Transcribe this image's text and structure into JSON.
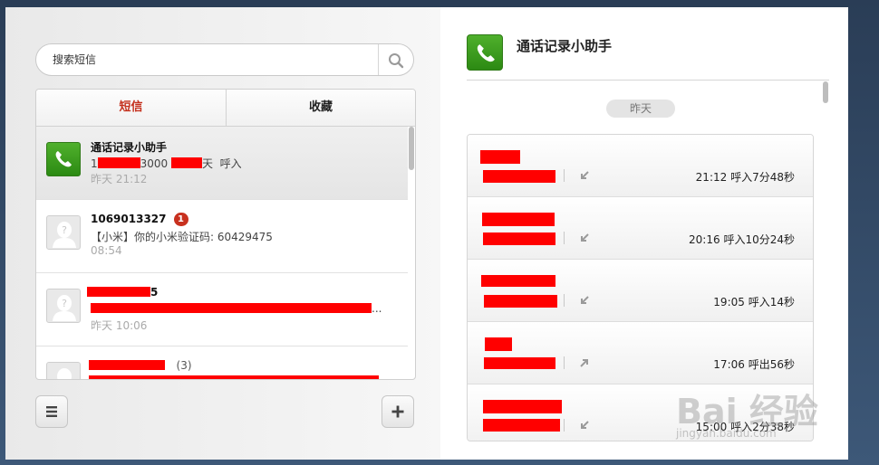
{
  "search": {
    "placeholder": "搜索短信"
  },
  "tabs": {
    "sms": "短信",
    "favorites": "收藏"
  },
  "threads": [
    {
      "name": "通话记录小助手",
      "preview_a": "1",
      "preview_b": "3000",
      "preview_c": "天",
      "preview_d": "呼入",
      "time": "昨天 21:12"
    },
    {
      "name": "1069013327",
      "badge": "1",
      "preview": "【小米】你的小米验证码: 60429475",
      "time": "08:54"
    },
    {
      "name": "5",
      "preview_tail": "...",
      "time": "昨天 10:06"
    },
    {
      "count": "(3)"
    }
  ],
  "detail": {
    "title": "通话记录小助手",
    "date": "昨天",
    "calls": [
      {
        "direction": "incoming",
        "time": "21:12",
        "info": "呼入7分48秒"
      },
      {
        "direction": "incoming",
        "time": "20:16",
        "info": "呼入10分24秒"
      },
      {
        "direction": "incoming",
        "time": "19:05",
        "info": "呼入14秒"
      },
      {
        "direction": "outgoing",
        "time": "17:06",
        "info": "呼出56秒"
      },
      {
        "direction": "incoming",
        "time": "15:00",
        "info": "呼入2分38秒"
      }
    ]
  },
  "icons": [
    "search-icon",
    "phone-icon",
    "contact-avatar-icon",
    "menu-icon",
    "add-icon",
    "incoming-call-icon",
    "outgoing-call-icon"
  ],
  "colors": {
    "accent": "#c4301d",
    "redaction": "#ff0000",
    "phone_green": "#3a9a1f"
  },
  "watermark": {
    "main": "Bai 经验",
    "url": "jingyan.baidu.com"
  }
}
